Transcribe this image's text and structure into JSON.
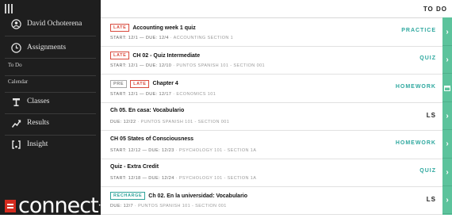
{
  "app": {
    "brand": "connect"
  },
  "sidebar": {
    "items": [
      {
        "label": "David Ochoterena",
        "icon": "user-circle-icon"
      },
      {
        "label": "Assignments",
        "icon": "clock-icon"
      },
      {
        "label": "To Do"
      },
      {
        "label": "Calendar"
      },
      {
        "label": "Classes",
        "icon": "lectern-icon"
      },
      {
        "label": "Results",
        "icon": "trend-up-icon"
      },
      {
        "label": "Insight",
        "icon": "insight-bracket-icon"
      }
    ]
  },
  "header": {
    "title": "TO DO"
  },
  "assignments": [
    {
      "badges": [
        "LATE"
      ],
      "title": "Accounting week 1 quiz",
      "dates": "START: 12/1 — DUE: 12/4",
      "course": "ACCOUNTING SECTION 1",
      "type": "PRACTICE"
    },
    {
      "badges": [
        "LATE"
      ],
      "title": "CH 02 - Quiz Intermediate",
      "dates": "START: 12/1 — DUE: 12/10",
      "course": "PUNTOS SPANISH 101 - SECTION 001",
      "type": "QUIZ"
    },
    {
      "badges": [
        "PRE",
        "LATE"
      ],
      "title": "Chapter 4",
      "dates": "START: 12/1 — DUE: 12/17",
      "course": "ECONOMICS 101",
      "type": "HOMEWORK"
    },
    {
      "badges": [],
      "title": "Ch 05. En casa: Vocabulario",
      "dates": "DUE: 12/22",
      "course": "PUNTOS SPANISH 101 - SECTION 001",
      "type": "LS"
    },
    {
      "badges": [],
      "title": "CH 05 States of Consciousness",
      "dates": "START: 12/12 — DUE: 12/23",
      "course": "PSYCHOLOGY 101 - SECTION 1A",
      "type": "HOMEWORK"
    },
    {
      "badges": [],
      "title": "Quiz - Extra Credit",
      "dates": "START: 12/18 — DUE: 12/24",
      "course": "PSYCHOLOGY 101 - SECTION 1A",
      "type": "QUIZ"
    },
    {
      "badges": [
        "RECHARGE"
      ],
      "title": "Ch 02. En la universidad: Vocabulario",
      "dates": "DUE: 12/7",
      "course": "PUNTOS SPANISH 101 - SECTION 001",
      "type": "LS"
    }
  ],
  "rail": {
    "chevron": "›",
    "calendar_icon": "calendar-icon"
  },
  "colors": {
    "sidebar": "#1e1e1e",
    "accent": "#2ea89f",
    "rail": "#5cc39c",
    "late": "#d94a3d"
  }
}
